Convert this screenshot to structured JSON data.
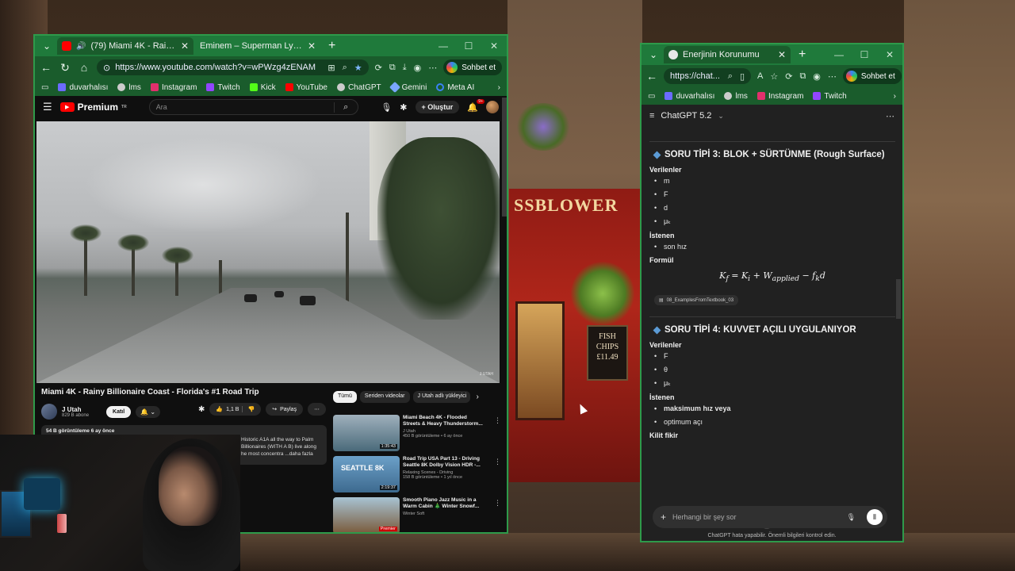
{
  "left_window": {
    "tabs": [
      {
        "title": "(79) Miami 4K - Rainy Billionaire",
        "favicon_color": "#ff0000",
        "active": true
      },
      {
        "title": "Eminem – Superman Lyrics | Genius",
        "favicon_color": "#ffff64",
        "active": false
      }
    ],
    "url": "https://www.youtube.com/watch?v=wPWzg4zENAM",
    "chat_button": "Sohbet et",
    "bookmarks": [
      {
        "label": "duvarhalısı",
        "color": "#6b6bff"
      },
      {
        "label": "lms",
        "color": "#cccccc"
      },
      {
        "label": "Instagram",
        "color": "#e1306c"
      },
      {
        "label": "Twitch",
        "color": "#9146ff"
      },
      {
        "label": "Kick",
        "color": "#53fc18"
      },
      {
        "label": "YouTube",
        "color": "#ff0000"
      },
      {
        "label": "ChatGPT",
        "color": "#cccccc"
      },
      {
        "label": "Gemini",
        "color": "#7aa7ff"
      },
      {
        "label": "Meta AI",
        "color": "#3b82f6"
      }
    ]
  },
  "youtube": {
    "logo": "Premium",
    "logo_badge": "TR",
    "search_placeholder": "Ara",
    "create_label": "Oluştur",
    "notification_count": "9+",
    "video_watermark": "J UTAH",
    "video_title": "Miami 4K - Rainy Billionaire Coast - Florida's #1 Road Trip",
    "channel_name": "J Utah",
    "subscribers": "829 B abone",
    "join_label": "Katıl",
    "like_count": "1,1 B",
    "share_label": "Paylaş",
    "views_date": "54 B görüntüleme  6 ay önce",
    "description": "Historic A1A all the way to Palm Billionaires (WITH A B) live along he most concentra  ...daha fazla",
    "chips": [
      "Tümü",
      "Seriden videolar",
      "J Utah adlı yükleyici"
    ],
    "recommendations": [
      {
        "title": "Miami Beach 4K - Flooded Streets & Heavy Thunderstorm...",
        "channel": "J Utah",
        "meta": "450 B görüntüleme • 6 ay önce",
        "duration": "1:35:43",
        "thumb": "#4a6a7a"
      },
      {
        "title": "Road Trip USA Part 13 - Driving Seattle 8K Dolby Vision HDR -...",
        "channel": "Relaxing Scenes - Driving",
        "meta": "158 B görüntüleme • 1 yıl önce",
        "duration": "2:19:37",
        "thumb": "#3d6a8f",
        "thumb_text": "SEATTLE 8K"
      },
      {
        "title": "Smooth Piano Jazz Music in a Warm Cabin 🎄 Winter Snowf...",
        "channel": "Winter Soft",
        "meta": "",
        "duration": "Premier",
        "thumb": "#7a5a3a"
      }
    ]
  },
  "right_window": {
    "tab_title": "Enerjinin Korunumu",
    "url": "https://chat...",
    "chat_button": "Sohbet et",
    "bookmarks": [
      {
        "label": "duvarhalısı",
        "color": "#6b6bff"
      },
      {
        "label": "lms",
        "color": "#cccccc"
      },
      {
        "label": "Instagram",
        "color": "#e1306c"
      },
      {
        "label": "Twitch",
        "color": "#9146ff"
      }
    ]
  },
  "chatgpt": {
    "model": "ChatGPT 5.2",
    "section3": {
      "heading": "SORU TİPİ 3: BLOK + SÜRTÜNME (Rough Surface)",
      "given_label": "Verilenler",
      "given": [
        "m",
        "F",
        "d",
        "μₖ"
      ],
      "asked_label": "İstenen",
      "asked": [
        "son hız"
      ],
      "formula_label": "Formül",
      "formula": "K_f = K_i + W_applied − f_k d",
      "source": "08_ExamplesFromTextbook_03"
    },
    "section4": {
      "heading": "SORU TİPİ 4: KUVVET AÇILI UYGULANIYOR",
      "given_label": "Verilenler",
      "given": [
        "F",
        "θ",
        "μₖ"
      ],
      "asked_label": "İstenen",
      "asked": [
        "maksimum hız veya",
        "optimum açı"
      ],
      "key_label": "Kilit fikir"
    },
    "input_placeholder": "Herhangi bir şey sor",
    "footer_note": "ChatGPT hata yapabilir. Önemli bilgileri kontrol edin."
  },
  "wallpaper": {
    "pub_sign": "SSBLOWER",
    "chips_board": [
      "FISH",
      "CHIPS",
      "£11.49"
    ]
  }
}
